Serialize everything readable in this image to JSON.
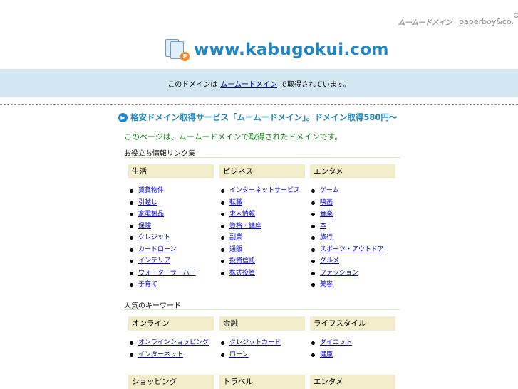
{
  "brand": {
    "mumu_logo": "ムームードメイン",
    "paperboy_logo": "paperboy&co."
  },
  "header": {
    "logo_badge": "P",
    "domain": "www.kabugokui.com"
  },
  "notice": {
    "prefix": "このドメインは",
    "link": "ムームードメイン",
    "suffix": "で取得されています。"
  },
  "promo": {
    "icon": "▶",
    "text": "格安ドメイン取得サービス「ムームードメイン」。ドメイン取得580円～"
  },
  "subtext": "このページは、ムームードメインで取得されたドメインです。",
  "sections": [
    {
      "heading": "お役立ち情報リンク集",
      "columns": [
        {
          "title": "生活",
          "items": [
            "賃貸物件",
            "引越し",
            "家電製品",
            "保険",
            "クレジット",
            "カードローン",
            "インテリア",
            "ウォーターサーバー",
            "子育て"
          ]
        },
        {
          "title": "ビジネス",
          "items": [
            "インターネットサービス",
            "転職",
            "求人情報",
            "資格・講座",
            "副業",
            "通販",
            "投資信託",
            "株式投資"
          ]
        },
        {
          "title": "エンタメ",
          "items": [
            "ゲーム",
            "映画",
            "音楽",
            "本",
            "旅行",
            "スポーツ・アウトドア",
            "グルメ",
            "ファッション",
            "美容"
          ]
        }
      ]
    },
    {
      "heading": "人気のキーワード",
      "columns": [
        {
          "title": "オンライン",
          "items": [
            "オンラインショッピング",
            "インターネット"
          ]
        },
        {
          "title": "金融",
          "items": [
            "クレジットカード",
            "ローン"
          ]
        },
        {
          "title": "ライフスタイル",
          "items": [
            "ダイエット",
            "健康"
          ]
        }
      ]
    },
    {
      "heading": "",
      "columns": [
        {
          "title": "ショッピング",
          "items": []
        },
        {
          "title": "トラベル",
          "items": []
        },
        {
          "title": "エンタメ",
          "items": []
        }
      ]
    }
  ]
}
